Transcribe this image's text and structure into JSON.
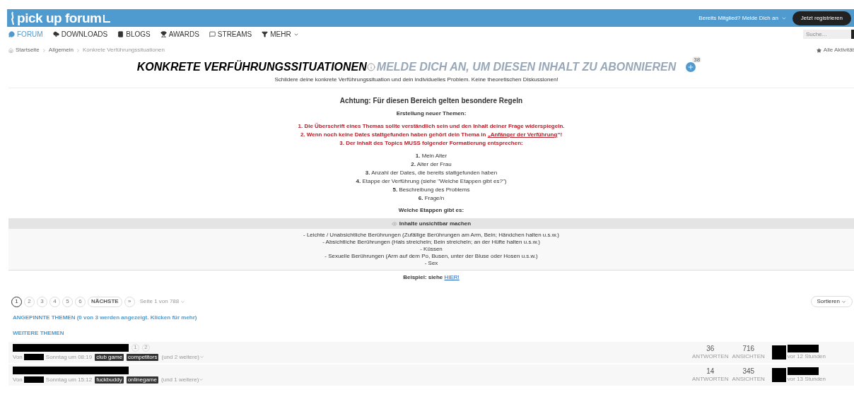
{
  "header": {
    "logo": "pick up forum",
    "login": "Bereits Mitglied? Melde Dich an",
    "register": "Jetzt registrieren"
  },
  "nav": [
    {
      "label": "FORUM",
      "selected": true
    },
    {
      "label": "DOWNLOADS",
      "selected": false
    },
    {
      "label": "BLOGS",
      "selected": false
    },
    {
      "label": "AWARDS",
      "selected": false
    },
    {
      "label": "STREAMS",
      "selected": false
    },
    {
      "label": "MEHR",
      "selected": false
    }
  ],
  "search": {
    "placeholder": "Suche..."
  },
  "breadcrumb": [
    "Startseite",
    "Allgemein",
    "Konkrete Verführungssituationen"
  ],
  "activity_link": "Alle Aktivität",
  "forum": {
    "title": "KONKRETE VERFÜHRUNGSSITUATIONEN",
    "subscribe": "MELDE DICH AN, UM DIESEN INHALT ZU ABONNIEREN",
    "followers": "38",
    "description": "Schildere deine konkrete Verführungssituation und dein individuelles Problem. Keine theoretischen Diskussionen!"
  },
  "rules": {
    "heading": "Achtung: Für diesen Bereich gelten besondere Regeln",
    "subheading": "Erstellung neuer Themen:",
    "red_lines": [
      {
        "before": "1. Die Überschrift eines Themas sollte verständlich sein und den Inhalt deiner Frage widerspiegeln."
      },
      {
        "before": "2. Wenn noch keine Dates stattgefunden haben gehört dein Thema in ",
        "link": "„Anfänger der Verführung",
        "after": "“!"
      },
      {
        "before": "3. Der Inhalt des Topics MUSS folgender Formatierung entsprechen:"
      }
    ],
    "format": [
      "**1.** Mein Alter",
      "**2.** Alter der Frau",
      "**3.** Anzahl der Dates, die bereits stattgefunden haben",
      "**4.** Etappe der Verführung (siehe \"Welche Etappen gibt es?\")",
      "**5.** Beschreibung des Problems",
      "**6.** Frage/n"
    ],
    "stages_heading": "Welche Etappen gibt es:",
    "spoiler": {
      "label": "Inhalte unsichtbar machen",
      "lines": [
        "- Leichte / Unabsichtliche Berührungen (Zufällige Berührungen am Arm, Bein; Händchen halten u.s.w.)",
        "- Absichtliche Berührungen (Hals streicheln; Bein streicheln; an der Hüfte halten u.s.w.)",
        "- Küssen",
        "- Sexuelle Berührungen (Arm auf dem Po, Busen, unter der Bluse oder Hosen u.s.w.)",
        "- Sex"
      ]
    },
    "example": {
      "text": "Beispiel: siehe ",
      "link": "HIER!"
    }
  },
  "pagination": {
    "pages": [
      {
        "label": "1",
        "selected": true
      },
      {
        "label": "2",
        "selected": false
      },
      {
        "label": "3",
        "selected": false
      },
      {
        "label": "4",
        "selected": false
      },
      {
        "label": "5",
        "selected": false
      },
      {
        "label": "6",
        "selected": false
      }
    ],
    "next": "NÄCHSTE",
    "last": "»",
    "page_info": "Seite 1 von 788"
  },
  "sort": "Sortieren",
  "pinned": "ANGEPINNTE THEMEN (0 von 3 werden angezeigt. Klicken für mehr)",
  "more_topics": "WEITERE THEMEN",
  "topics": [
    {
      "pages": [
        "1",
        "2"
      ],
      "by": "Von",
      "date": "Sonntag um 08:19",
      "tags": [
        "club game",
        "competitors"
      ],
      "more_tags": "(und 2 weitere)",
      "replies": "36",
      "replies_label": "ANTWORTEN",
      "views": "716",
      "views_label": "ANSICHTEN",
      "last_time": "vor 12 Stunden"
    },
    {
      "by": "Von",
      "date": "Sonntag um 15:12",
      "tags": [
        "fuckbuddy",
        "onlinegame"
      ],
      "more_tags": "(und 1 weitere)",
      "replies": "14",
      "replies_label": "ANTWORTEN",
      "views": "345",
      "views_label": "ANSICHTEN",
      "last_time": "vor 13 Stunden"
    }
  ]
}
